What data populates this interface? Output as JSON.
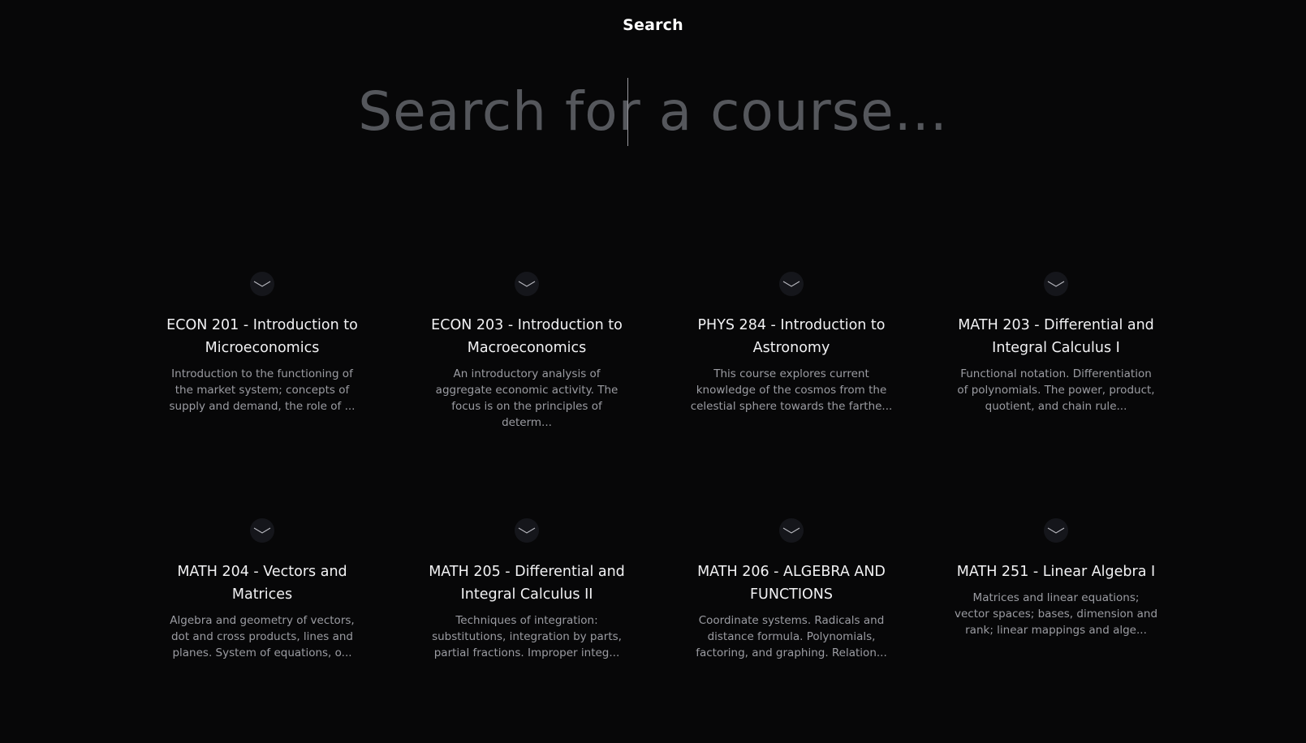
{
  "header": {
    "title": "Search"
  },
  "search": {
    "placeholder": "Search for a course...",
    "value": ""
  },
  "courses": [
    {
      "title": "ECON 201 - Introduction to Microeconomics",
      "description": "Introduction to the functioning of the market system; concepts of supply and demand, the role of ...",
      "icon": "chevron-down-icon"
    },
    {
      "title": "ECON 203 - Introduction to Macroeconomics",
      "description": "An introductory analysis of aggregate economic activity. The focus is on the principles of determ...",
      "icon": "chevron-down-icon"
    },
    {
      "title": "PHYS 284 - Introduction to Astronomy",
      "description": "This course explores current knowledge of the cosmos from the celestial sphere towards the farthe...",
      "icon": "chevron-down-icon"
    },
    {
      "title": "MATH 203 - Differential and Integral Calculus I",
      "description": "Functional notation. Differentiation of polynomials. The power, product, quotient, and chain rule...",
      "icon": "chevron-down-icon"
    },
    {
      "title": "MATH 204 - Vectors and Matrices",
      "description": "Algebra and geometry of vectors, dot and cross products, lines and planes. System of equations, o...",
      "icon": "chevron-down-icon"
    },
    {
      "title": "MATH 205 - Differential and Integral Calculus II",
      "description": "Techniques of integration: substitutions, integration by parts, partial fractions. Improper integ...",
      "icon": "chevron-down-icon"
    },
    {
      "title": "MATH 206 - ALGEBRA AND FUNCTIONS",
      "description": "Coordinate systems. Radicals and distance formula. Polynomials, factoring, and graphing. Relation...",
      "icon": "chevron-down-icon"
    },
    {
      "title": "MATH 251 - Linear Algebra I",
      "description": "Matrices and linear equations; vector spaces; bases, dimension and rank; linear mappings and alge...",
      "icon": "chevron-down-icon"
    }
  ],
  "colors": {
    "background": "#070708",
    "title": "#ffffff",
    "placeholder": "#55575c",
    "card_title": "#f2f2f4",
    "card_description": "#9b9ca2",
    "icon_bg": "#15161b"
  }
}
